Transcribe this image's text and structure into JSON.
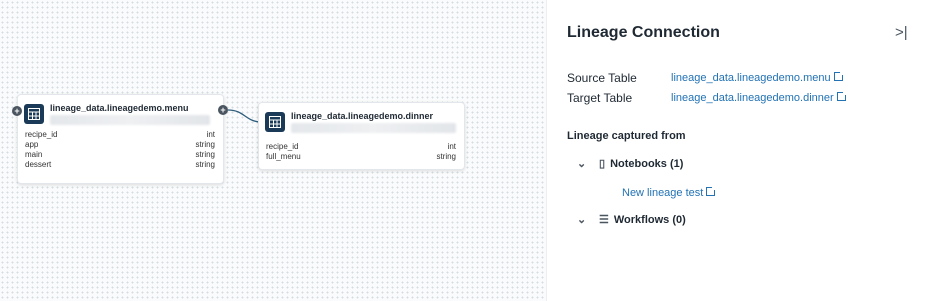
{
  "graph": {
    "source_node": {
      "title": "lineage_data.lineagedemo.menu",
      "columns": [
        {
          "name": "recipe_id",
          "type": "int"
        },
        {
          "name": "app",
          "type": "string"
        },
        {
          "name": "main",
          "type": "string"
        },
        {
          "name": "dessert",
          "type": "string"
        }
      ]
    },
    "target_node": {
      "title": "lineage_data.lineagedemo.dinner",
      "columns": [
        {
          "name": "recipe_id",
          "type": "int"
        },
        {
          "name": "full_menu",
          "type": "string"
        }
      ]
    }
  },
  "panel": {
    "title": "Lineage Connection",
    "collapse_icon": ">|",
    "source_label": "Source Table",
    "source_value": "lineage_data.lineagedemo.menu",
    "target_label": "Target Table",
    "target_value": "lineage_data.lineagedemo.dinner",
    "captured_label": "Lineage captured from",
    "notebooks_label": "Notebooks (1)",
    "notebook_item": "New lineage test",
    "workflows_label": "Workflows (0)"
  },
  "colors": {
    "accent": "#2272b4",
    "node_icon": "#1b3a57"
  }
}
